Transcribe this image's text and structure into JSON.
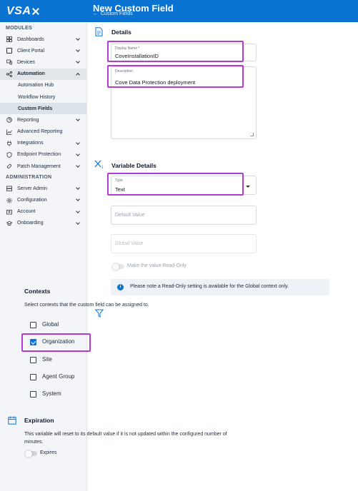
{
  "header": {
    "logo": "VSA",
    "title": "New Custom Field",
    "back_link": "Custom Fields"
  },
  "sidebar": {
    "modules_heading": "MODULES",
    "administration_heading": "ADMINISTRATION",
    "items": [
      {
        "label": "Dashboards",
        "icon": "dashboard-icon"
      },
      {
        "label": "Client Portal",
        "icon": "portal-icon"
      },
      {
        "label": "Devices",
        "icon": "devices-icon"
      },
      {
        "label": "Automation",
        "icon": "automation-icon"
      },
      {
        "label": "Automation Hub"
      },
      {
        "label": "Workflow History"
      },
      {
        "label": "Custom Fields"
      },
      {
        "label": "Reporting",
        "icon": "reporting-icon"
      },
      {
        "label": "Advanced Reporting",
        "icon": "chart-icon"
      },
      {
        "label": "Integrations",
        "icon": "plug-icon"
      },
      {
        "label": "Endpoint Protection",
        "icon": "shield-icon"
      },
      {
        "label": "Patch Management",
        "icon": "patch-icon"
      }
    ],
    "admin_items": [
      {
        "label": "Server Admin",
        "icon": "server-icon"
      },
      {
        "label": "Configuration",
        "icon": "gear-icon"
      },
      {
        "label": "Account",
        "icon": "account-icon"
      },
      {
        "label": "Onboarding",
        "icon": "onboarding-icon"
      }
    ]
  },
  "details": {
    "title": "Details",
    "display_name_label": "Display Name *",
    "display_name_value": "CoveInstallationID",
    "description_label": "Description",
    "description_value": "Cove Data Protection deployment"
  },
  "variable_details": {
    "title": "Variable Details",
    "type_label": "Type",
    "type_value": "Text",
    "default_value_placeholder": "Default Value",
    "global_value_placeholder": "Global Value",
    "readonly_toggle_label": "Make the value Read-Only",
    "info_text": "Please note a Read-Only setting is available for the Global context only."
  },
  "contexts": {
    "title": "Contexts",
    "subtitle": "Select contexts that the custom field can be assigned to.",
    "options": [
      {
        "label": "Global",
        "checked": false
      },
      {
        "label": "Organization",
        "checked": true
      },
      {
        "label": "Site",
        "checked": false
      },
      {
        "label": "Agent Group",
        "checked": false
      },
      {
        "label": "System",
        "checked": false
      }
    ]
  },
  "expiration": {
    "title": "Expiration",
    "description": "This variable will reset to its default value if it is not updated within the configured number of minutes.",
    "toggle_label": "Expires"
  },
  "colors": {
    "brand_blue": "#0a73d2",
    "highlight_purple": "#b53bd7"
  }
}
